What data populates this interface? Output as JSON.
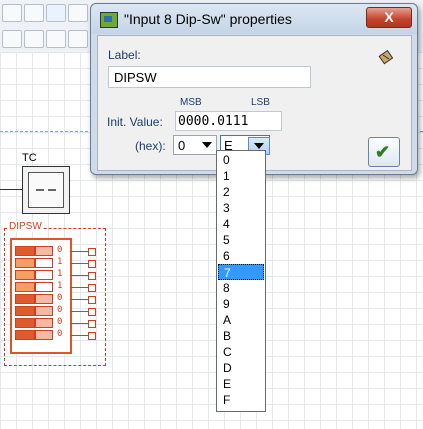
{
  "dialog": {
    "title": "\"Input 8 Dip-Sw\" properties",
    "close_label": "X",
    "label_caption": "Label:",
    "label_value": "DIPSW",
    "msb_label": "MSB",
    "lsb_label": "LSB",
    "init_caption": "Init. Value:",
    "init_value": "0000.0111",
    "hex_caption": "(hex):",
    "hex_high": "0",
    "hex_low": "E",
    "ok_icon": "check-icon",
    "side_icon": "eraser-icon"
  },
  "dropdown": {
    "items": [
      "0",
      "1",
      "2",
      "3",
      "4",
      "5",
      "6",
      "7",
      "8",
      "9",
      "A",
      "B",
      "C",
      "D",
      "E",
      "F"
    ],
    "selected": "7"
  },
  "canvas": {
    "tc_label": "TC",
    "dip_label": "DIPSW",
    "dip_values": [
      "0",
      "1",
      "1",
      "1",
      "0",
      "0",
      "0",
      "0"
    ]
  },
  "colors": {
    "component_accent": "#e0542a",
    "selection_blue": "#3399ff",
    "dialog_frame": "#cfdbe9",
    "close_red": "#c3422c"
  }
}
